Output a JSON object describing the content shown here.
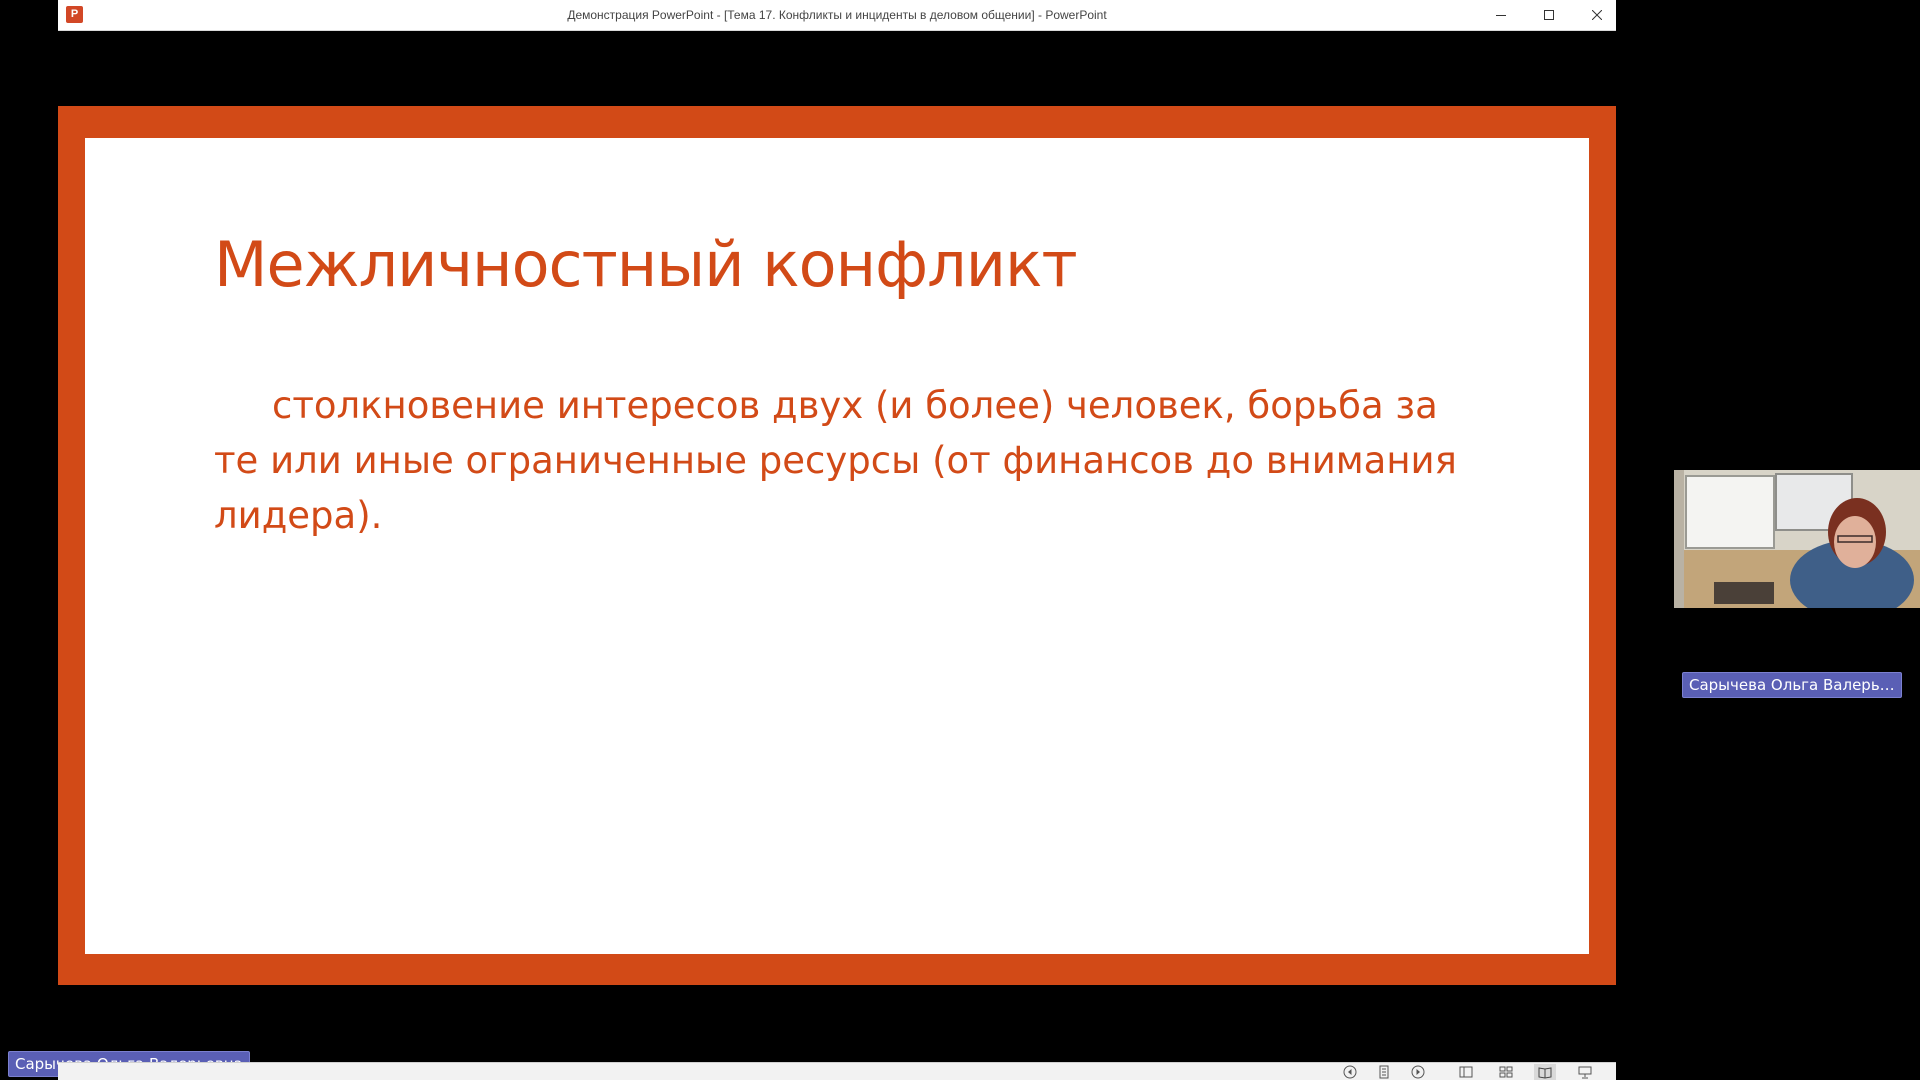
{
  "window": {
    "title": "Демонстрация PowerPoint - [Тема  17. Конфликты и инциденты в деловом общении] - PowerPoint",
    "app_icon_letter": "P",
    "controls": [
      "minimize-icon",
      "maximize-icon",
      "close-icon"
    ]
  },
  "slide": {
    "title": "Межличностный конфликт",
    "body": "столкновение интересов двух (и более) человек, борьба за те или иные ограниченные ресурсы (от финансов до внимания лидера).",
    "frame_color": "#d24a17",
    "text_color": "#d24a17"
  },
  "participants": {
    "webcam_name": "Сарычева Ольга Валерье...",
    "presenter_name": "Сарычева Ольга Валерьевна",
    "tag_color": "#5a5fb5"
  },
  "statusbar": {
    "buttons": [
      "previous-slide-icon",
      "slide-menu-icon",
      "next-slide-icon",
      "normal-view-icon",
      "slide-sorter-icon",
      "reading-view-icon",
      "slideshow-icon"
    ]
  }
}
